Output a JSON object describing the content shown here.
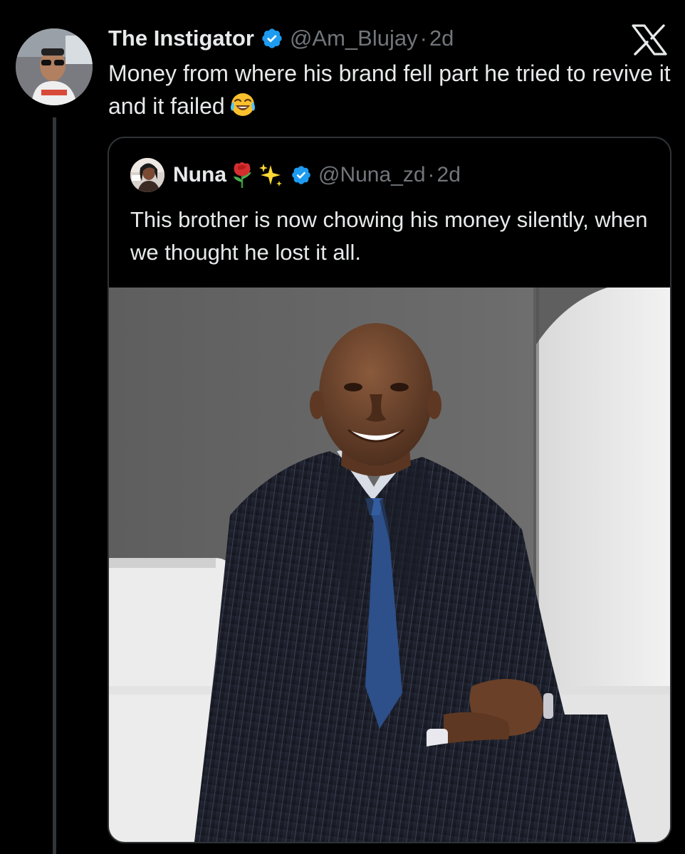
{
  "tweet": {
    "display_name": "The Instigator",
    "handle": "@Am_Blujay",
    "separator": "·",
    "time": "2d",
    "text": "Money from where his brand fell part he tried to revive it and it failed",
    "emoji": "face-with-tears-of-joy"
  },
  "brand": {
    "logo": "x-logo"
  },
  "quote": {
    "display_name": "Nuna",
    "emojis": [
      "rose",
      "sparkles"
    ],
    "handle": "@Nuna_zd",
    "separator": "·",
    "time": "2d",
    "text": "This brother is now chowing his money silently,  when we thought he lost it all.",
    "media": "photo-man-in-pinstripe-suit"
  },
  "colors": {
    "background": "#000000",
    "text_primary": "#e7e9ea",
    "text_secondary": "#71767b",
    "verified_blue": "#1d9bf0",
    "border": "#2f3336"
  }
}
